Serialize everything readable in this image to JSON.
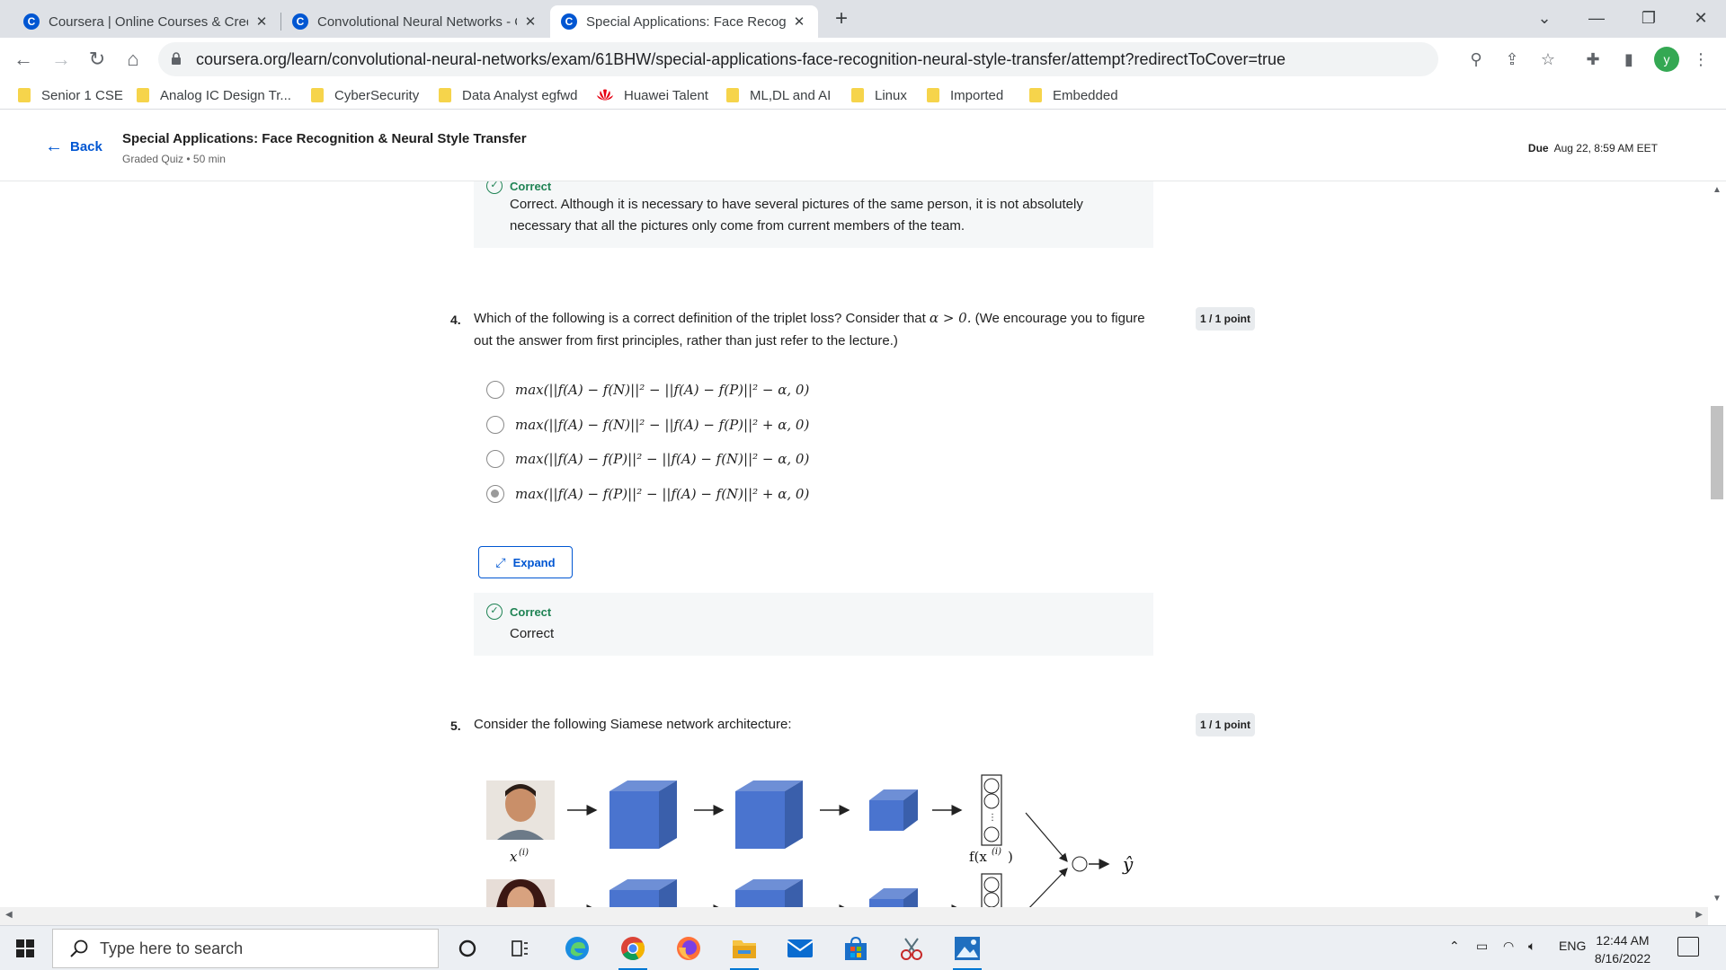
{
  "browser": {
    "tabs": [
      {
        "title": "Coursera | Online Courses & Credentials",
        "active": false
      },
      {
        "title": "Convolutional Neural Networks - Coursera",
        "active": false
      },
      {
        "title": "Special Applications: Face Recognition",
        "active": true
      }
    ],
    "new_tab_label": "+",
    "url": "coursera.org/learn/convolutional-neural-networks/exam/61BHW/special-applications-face-recognition-neural-style-transfer/attempt?redirectToCover=true",
    "profile_initial": "y",
    "bookmarks": [
      {
        "label": "Senior 1 CSE",
        "icon": "folder-icon"
      },
      {
        "label": "Analog IC Design Tr...",
        "icon": "folder-icon"
      },
      {
        "label": "CyberSecurity",
        "icon": "folder-icon"
      },
      {
        "label": "Data Analyst egfwd",
        "icon": "folder-icon"
      },
      {
        "label": "Huawei Talent",
        "icon": "huawei-logo-icon"
      },
      {
        "label": "ML,DL and AI",
        "icon": "folder-icon"
      },
      {
        "label": "Linux",
        "icon": "folder-icon"
      },
      {
        "label": "Imported",
        "icon": "folder-icon"
      },
      {
        "label": "Embedded",
        "icon": "folder-icon"
      }
    ]
  },
  "header": {
    "back_label": "Back",
    "title": "Special Applications: Face Recognition & Neural Style Transfer",
    "subtitle": "Graded Quiz • 50 min",
    "due_label": "Due",
    "due_value": "Aug 22, 8:59 AM EET"
  },
  "q3_feedback": {
    "label": "Correct",
    "text": "Correct. Although it is necessary to have several pictures of the same person, it is not absolutely necessary that all the pictures only come from current members of the team."
  },
  "q4": {
    "number": "4.",
    "text_before": "Which of the following is a correct definition of the triplet loss? Consider that",
    "math": "α > 0.",
    "text_after": "(We encourage you to figure out the answer from first principles, rather than just refer to the lecture.)",
    "points": "1 / 1 point",
    "options": [
      {
        "formula": "max(||f(A) − f(N)||² − ||f(A) − f(P)||² − α, 0)",
        "selected": false
      },
      {
        "formula": "max(||f(A) − f(N)||² − ||f(A) − f(P)||² + α, 0)",
        "selected": false
      },
      {
        "formula": "max(||f(A) − f(P)||² − ||f(A) − f(N)||² − α, 0)",
        "selected": false
      },
      {
        "formula": "max(||f(A) − f(P)||² − ||f(A) − f(N)||² + α, 0)",
        "selected": true
      }
    ],
    "expand_label": "Expand",
    "feedback_label": "Correct",
    "feedback_text": "Correct"
  },
  "q5": {
    "number": "5.",
    "text": "Consider the following Siamese network architecture:",
    "points": "1 / 1 point",
    "diagram": {
      "input_label": "x",
      "input_sup": "(i)",
      "encoding_label": "f(x",
      "encoding_sup": "(i)",
      "encoding_close": ")",
      "output_label": "ŷ"
    }
  },
  "taskbar": {
    "search_placeholder": "Type here to search",
    "language": "ENG",
    "time": "12:44 AM",
    "date": "8/16/2022"
  }
}
